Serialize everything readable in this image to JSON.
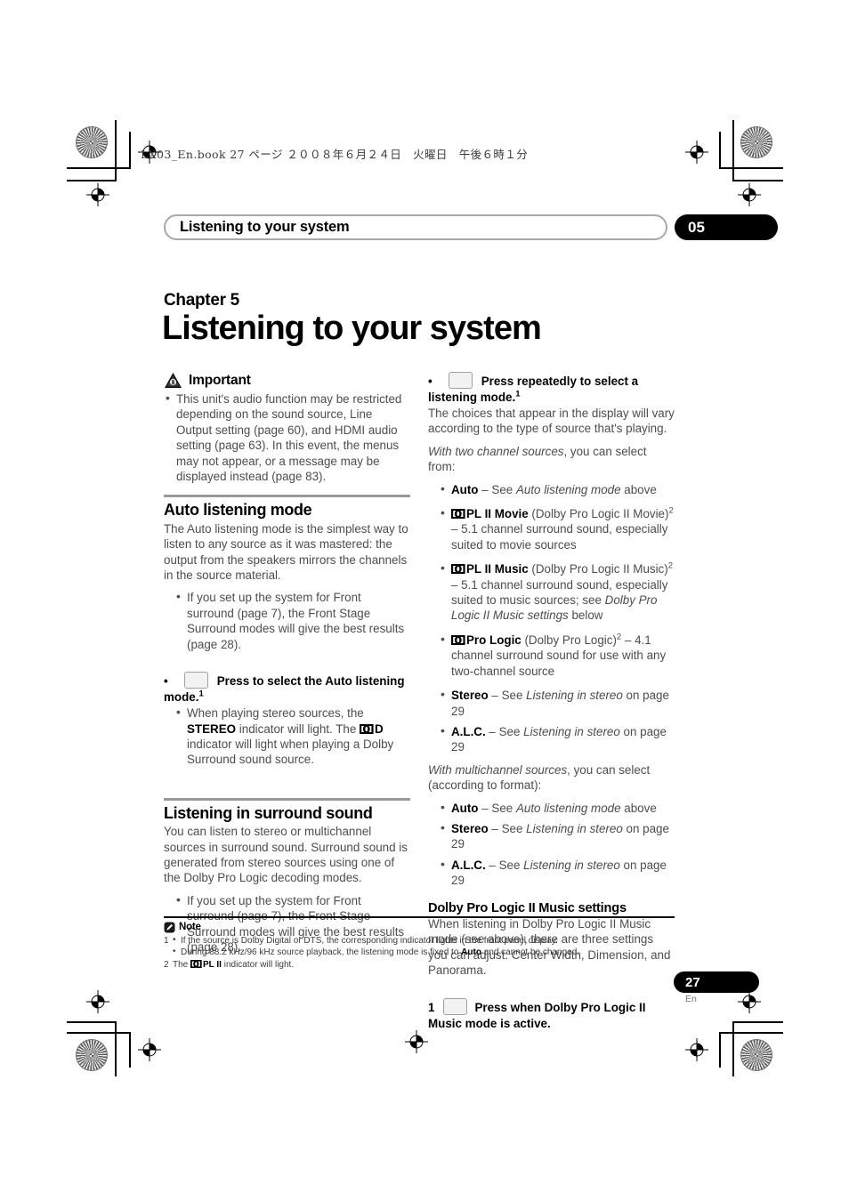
{
  "print_marks": {
    "book_line": "LX03_En.book  27 ページ  ２００８年６月２４日　火曜日　午後６時１分"
  },
  "running_head": {
    "title": "Listening to your system",
    "chapter_number": "05"
  },
  "chapter": {
    "label": "Chapter 5",
    "title": "Listening to your system"
  },
  "left_column": {
    "important": {
      "icon": "warning-triangle-icon",
      "heading": "Important",
      "bullets": [
        "This unit's audio function may be restricted depending on the sound source, Line Output setting (page 60), and HDMI audio setting (page 63). In this event, the menus may not appear, or a message may be displayed instead (page 83)."
      ]
    },
    "auto_listening": {
      "heading": "Auto listening mode",
      "body": "The Auto listening mode is the simplest way to listen to any source as it was mastered: the output from the speakers mirrors the channels in the source material.",
      "bullets": [
        "If you set up the system for Front surround (page 7), the Front Stage Surround modes will give the best results (page 28)."
      ],
      "step": {
        "bullet": "•",
        "button_icon": "remote-button-placeholder",
        "text_before": "Press to select the Auto listening mode.",
        "footnote_marker": "1"
      },
      "step_bullets_pre": "When playing stereo sources, the ",
      "step_bullets_mid": " indicator will light. The ",
      "step_bullets_post": " indicator will light when playing a Dolby Surround sound source.",
      "stereo_label": "STEREO",
      "dolby_d_label": "D"
    },
    "surround": {
      "heading": "Listening in surround sound",
      "body": "You can listen to stereo or multichannel sources in surround sound. Surround sound is generated from stereo sources using one of the Dolby Pro Logic decoding modes.",
      "bullets": [
        "If you set up the system for Front surround (page 7), the Front Stage Surround modes will give the best results (page 28)."
      ]
    }
  },
  "right_column": {
    "step": {
      "bullet": "•",
      "button_icon": "remote-button-placeholder",
      "text": "Press repeatedly to select a listening mode.",
      "footnote_marker": "1"
    },
    "intro": "The choices that appear in the display will vary according to the type of source that's playing.",
    "two_channel_lead_italic": "With two channel sources",
    "two_channel_lead_rest": ", you can select from:",
    "two_channel_items": [
      {
        "dolby": false,
        "name": "Auto",
        "dash": " – See ",
        "italic": "Auto listening mode",
        "tail": " above",
        "sup": ""
      },
      {
        "dolby": true,
        "name": "PL II Movie",
        "dash": " (Dolby Pro Logic II Movie)",
        "sup": "2",
        "tail": " – 5.1 channel surround sound, especially suited to movie sources",
        "italic": ""
      },
      {
        "dolby": true,
        "name": "PL II Music",
        "dash": " (Dolby Pro Logic II Music)",
        "sup": "2",
        "tail": " – 5.1 channel surround sound, especially suited to music sources; see ",
        "italic": "Dolby Pro Logic II Music settings",
        "tail2": " below"
      },
      {
        "dolby": true,
        "name": "Pro Logic",
        "dash": " (Dolby Pro Logic)",
        "sup": "2",
        "tail": " – 4.1 channel surround sound for use with any two-channel source",
        "italic": ""
      },
      {
        "dolby": false,
        "name": "Stereo",
        "dash": " – See ",
        "italic": "Listening in stereo",
        "tail": " on page 29",
        "sup": ""
      },
      {
        "dolby": false,
        "name": "A.L.C.",
        "dash": " – See ",
        "italic": "Listening in stereo",
        "tail": " on page 29",
        "sup": ""
      }
    ],
    "multichannel_lead_italic": "With multichannel sources",
    "multichannel_lead_rest": ", you can select (according to format):",
    "multichannel_items": [
      {
        "name": "Auto",
        "dash": " – See ",
        "italic": "Auto listening mode",
        "tail": " above"
      },
      {
        "name": "Stereo",
        "dash": " – See ",
        "italic": "Listening in stereo",
        "tail": " on page 29"
      },
      {
        "name": "A.L.C.",
        "dash": " – See ",
        "italic": "Listening in stereo",
        "tail": " on page 29"
      }
    ],
    "plii_settings": {
      "heading": "Dolby Pro Logic II Music settings",
      "body": "When listening in Dolby Pro Logic II Music mode (see above), there are three settings you can adjust: Center Width, Dimension, and Panorama.",
      "step_number": "1",
      "step_button_icon": "remote-button-placeholder",
      "step_text": "Press when Dolby Pro Logic II Music mode is active."
    }
  },
  "footnotes": {
    "icon": "note-icon",
    "heading": "Note",
    "items": [
      {
        "num": "1",
        "lines": [
          {
            "pre": "If the source is Dolby Digital or DTS, the corresponding indicator lights in the front panel display.",
            "bold": "",
            "post": ""
          },
          {
            "pre": "During 88.2 kHz/96 kHz source playback, the listening mode is fixed to ",
            "bold": "Auto",
            "post": " and cannot be changed."
          }
        ]
      },
      {
        "num": "2",
        "plain_pre": "The ",
        "dolby": true,
        "bold_mid": "PL II",
        "plain_post": " indicator will light."
      }
    ]
  },
  "page_footer": {
    "number": "27",
    "language": "En"
  }
}
